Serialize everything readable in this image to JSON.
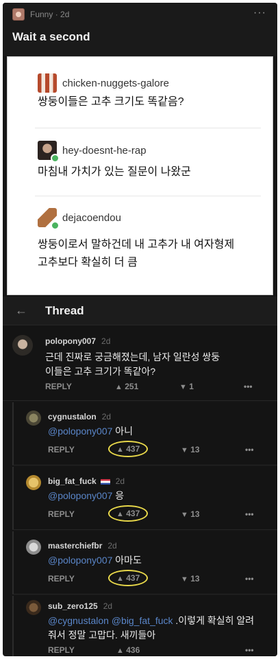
{
  "post": {
    "subreddit": "Funny",
    "age": "2d",
    "more": "···",
    "title": "Wait a second"
  },
  "tumblr": [
    {
      "user": "chicken-nuggets-galore",
      "text": "쌍둥이들은 고추 크기도 똑같음?"
    },
    {
      "user": "hey-doesnt-he-rap",
      "text": "마침내 가치가 있는 질문이 나왔군"
    },
    {
      "user": "dejacoendou",
      "text_line1": "쌍둥이로서 말하건데 내 고추가 내 여자형제",
      "text_line2": "고추보다 확실히 더 큼"
    }
  ],
  "thread": {
    "back": "←",
    "title": "Thread"
  },
  "comments": [
    {
      "user": "polopony007",
      "age": "2d",
      "line1": "근데 진짜로 궁금해졌는데, 남자 일란성 쌍둥",
      "line2": "이들은 고추 크기가 똑같아?",
      "reply": "REPLY",
      "up": "251",
      "down": "1",
      "more": "•••"
    },
    {
      "user": "cygnustalon",
      "age": "2d",
      "mention": "@polopony007",
      "text": "아니",
      "reply": "REPLY",
      "up": "437",
      "down": "13",
      "more": "•••"
    },
    {
      "user": "big_fat_fuck",
      "age": "2d",
      "mention": "@polopony007",
      "text": "응",
      "reply": "REPLY",
      "up": "437",
      "down": "13",
      "more": "•••"
    },
    {
      "user": "masterchiefbr",
      "age": "2d",
      "mention": "@polopony007",
      "text": "아마도",
      "reply": "REPLY",
      "up": "437",
      "down": "13",
      "more": "•••"
    },
    {
      "user": "sub_zero125",
      "age": "2d",
      "mention": "@cygnustalon @big_fat_fuck",
      "text": ".이렇게 확실히 알려",
      "line2": "줘서 정말 고맙다. 새끼들아",
      "reply": "REPLY",
      "up": "436",
      "more": "•••"
    }
  ],
  "icons": {
    "upvote": "➜",
    "downvote": "➜"
  }
}
